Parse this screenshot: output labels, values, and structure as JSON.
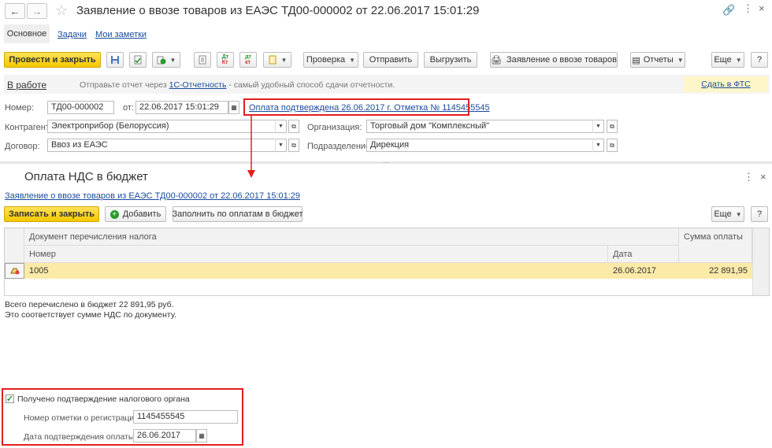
{
  "window": {
    "title": "Заявление о ввозе товаров из ЕАЭС ТД00-000002 от 22.06.2017 15:01:29",
    "tabs": [
      "Основное",
      "Задачи",
      "Мои заметки"
    ]
  },
  "toolbar": {
    "post_close": "Провести и закрыть",
    "check": "Проверка",
    "send": "Отправить",
    "upload": "Выгрузить",
    "print_doc": "Заявление о ввозе товаров",
    "reports": "Отчеты",
    "more": "Еще",
    "help": "?"
  },
  "status": {
    "state": "В работе",
    "message_prefix": "Отправьте отчет через ",
    "message_link": "1С-Отчетность",
    "message_suffix": " - самый удобный способ сдачи отчетности.",
    "fts_link": "Сдать в ФТС"
  },
  "form": {
    "number_label": "Номер:",
    "number": "ТД00-000002",
    "from_label": "от:",
    "date": "22.06.2017 15:01:29",
    "payment_link": "Оплата подтверждена 26.06.2017 г. Отметка № 1145455545",
    "counterparty_label": "Контрагент:",
    "counterparty": "Электроприбор (Белоруссия)",
    "organization_label": "Организация:",
    "organization": "Торговый дом \"Комплексный\"",
    "contract_label": "Договор:",
    "contract": "Ввоз из ЕАЭС",
    "division_label": "Подразделение:",
    "division": "Дирекция"
  },
  "sub": {
    "title": "Оплата НДС в бюджет",
    "doc_link": "Заявление о ввозе товаров из ЕАЭС ТД00-000002 от 22.06.2017 15:01:29",
    "save_close": "Записать и закрыть",
    "add": "Добавить",
    "fill": "Заполнить по оплатам в бюджет",
    "more": "Еще",
    "help": "?",
    "table": {
      "group_header": "Документ перечисления налога",
      "col_number": "Номер",
      "col_date": "Дата",
      "col_sum": "Сумма оплаты",
      "rows": [
        {
          "number": "1005",
          "date": "26.06.2017",
          "sum": "22 891,95"
        }
      ]
    },
    "summary_line1": "Всего перечислено в бюджет 22 891,95 руб.",
    "summary_line2": "Это соответствует сумме НДС по документу.",
    "confirm_checkbox": "Получено подтверждение налогового органа",
    "confirm_checked": true,
    "reg_label": "Номер отметки о регистрации:",
    "reg_value": "1145455545",
    "pay_date_label": "Дата подтверждения оплаты:",
    "pay_date_value": "26.06.2017"
  },
  "colors": {
    "accent_yellow": "#f5c800",
    "link_blue": "#1a4b9c",
    "highlight_red": "#e0201e",
    "row_selected": "#fbeaa8"
  }
}
